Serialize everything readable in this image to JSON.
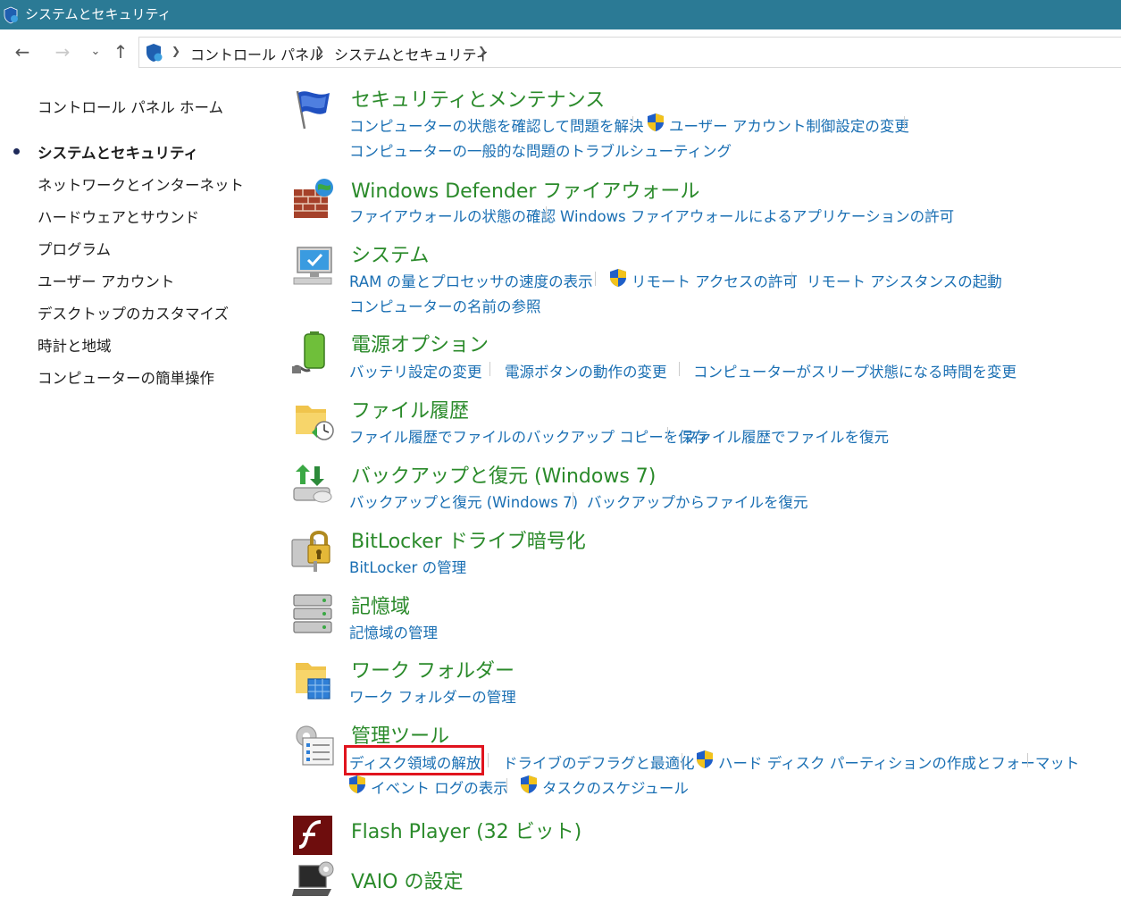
{
  "window": {
    "title": "システムとセキュリティ"
  },
  "breadcrumb": {
    "items": [
      "コントロール パネル",
      "システムとセキュリティ"
    ]
  },
  "nav": {
    "back": "←",
    "forward": "→",
    "recent": "⌄",
    "up": "↑"
  },
  "sidebar": {
    "home": "コントロール パネル ホーム",
    "items": [
      "システムとセキュリティ",
      "ネットワークとインターネット",
      "ハードウェアとサウンド",
      "プログラム",
      "ユーザー アカウント",
      "デスクトップのカスタマイズ",
      "時計と地域",
      "コンピューターの簡単操作"
    ]
  },
  "categories": {
    "security": {
      "title": "セキュリティとメンテナンス",
      "links": [
        "コンピューターの状態を確認して問題を解決",
        "ユーザー アカウント制御設定の変更",
        "コンピューターの一般的な問題のトラブルシューティング"
      ]
    },
    "firewall": {
      "title": "Windows Defender ファイアウォール",
      "links": [
        "ファイアウォールの状態の確認",
        "Windows ファイアウォールによるアプリケーションの許可"
      ]
    },
    "system": {
      "title": "システム",
      "links": [
        "RAM の量とプロセッサの速度の表示",
        "リモート アクセスの許可",
        "リモート アシスタンスの起動",
        "コンピューターの名前の参照"
      ]
    },
    "power": {
      "title": "電源オプション",
      "links": [
        "バッテリ設定の変更",
        "電源ボタンの動作の変更",
        "コンピューターがスリープ状態になる時間を変更"
      ]
    },
    "filehistory": {
      "title": "ファイル履歴",
      "links": [
        "ファイル履歴でファイルのバックアップ コピーを保存",
        "ファイル履歴でファイルを復元"
      ]
    },
    "backup": {
      "title": "バックアップと復元 (Windows 7)",
      "links": [
        "バックアップと復元 (Windows 7)",
        "バックアップからファイルを復元"
      ]
    },
    "bitlocker": {
      "title": "BitLocker ドライブ暗号化",
      "links": [
        "BitLocker の管理"
      ]
    },
    "storage": {
      "title": "記憶域",
      "links": [
        "記憶域の管理"
      ]
    },
    "workfolders": {
      "title": "ワーク フォルダー",
      "links": [
        "ワーク フォルダーの管理"
      ]
    },
    "admintools": {
      "title": "管理ツール",
      "links": [
        "ディスク領域の解放",
        "ドライブのデフラグと最適化",
        "ハード ディスク パーティションの作成とフォーマット",
        "イベント ログの表示",
        "タスクのスケジュール"
      ]
    },
    "flash": {
      "title": "Flash Player (32 ビット)"
    },
    "vaio": {
      "title": "VAIO の設定"
    }
  },
  "colors": {
    "titlebar": "#2b7a95",
    "category_title": "#2a8a2a",
    "link": "#1a6fb3",
    "highlight": "#e0141e"
  }
}
